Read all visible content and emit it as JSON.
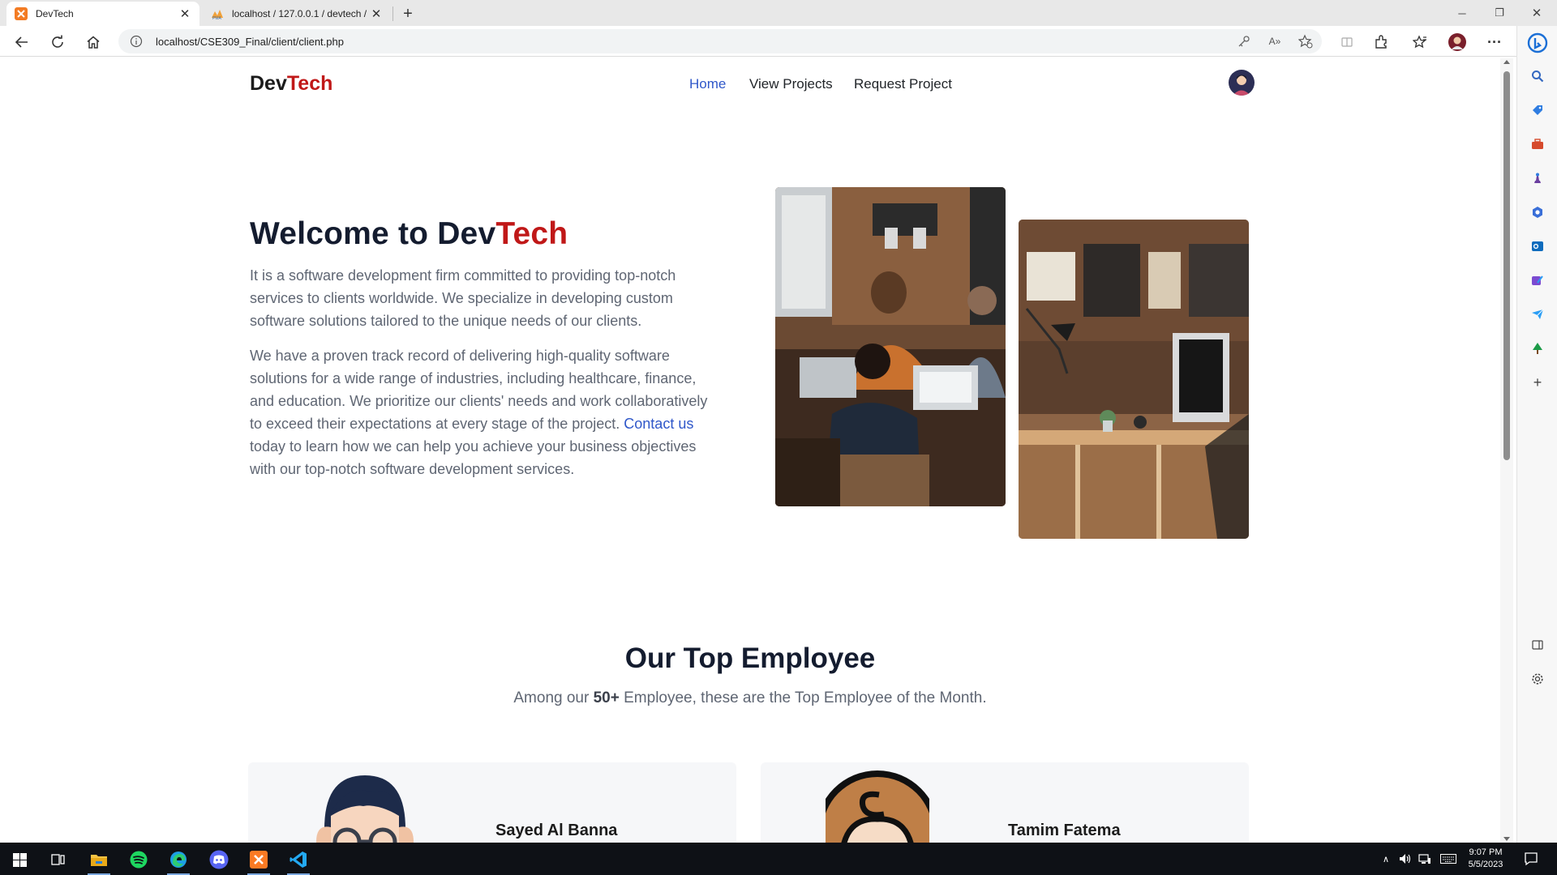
{
  "browser": {
    "tabs": [
      {
        "title": "DevTech",
        "active": true
      },
      {
        "title": "localhost / 127.0.0.1 / devtech / …",
        "active": false
      }
    ],
    "url": "localhost/CSE309_Final/client/client.php"
  },
  "site": {
    "brand_main": "Dev",
    "brand_accent": "Tech",
    "nav": [
      "Home",
      "View Projects",
      "Request Project"
    ],
    "active_nav": "Home"
  },
  "hero": {
    "title_prefix": "Welcome to Dev",
    "title_accent": "Tech",
    "paragraph1": "It is a software development firm committed to providing top-notch services to clients worldwide. We specialize in developing custom software solutions tailored to the unique needs of our clients.",
    "paragraph2_before": "We have a proven track record of delivering high-quality software solutions for a wide range of industries, including healthcare, finance, and education. We prioritize our clients' needs and work collaboratively to exceed their expectations at every stage of the project. ",
    "contact_link": "Contact us",
    "paragraph2_after": " today to learn how we can help you achieve your business objectives with our top-notch software development services."
  },
  "team": {
    "title": "Our Top Employee",
    "subtitle_before": "Among our ",
    "subtitle_bold": "50+",
    "subtitle_after": " Employee, these are the Top Employee of the Month.",
    "employees": [
      {
        "name": "Sayed Al Banna",
        "avatar": "man-with-glasses-avatar"
      },
      {
        "name": "Tamim Fatema",
        "avatar": "woman-avatar"
      }
    ]
  },
  "taskbar": {
    "apps": [
      "file-explorer",
      "spotify",
      "edge",
      "discord",
      "xampp",
      "vscode"
    ],
    "time": "9:07 PM",
    "date": "5/5/2023"
  },
  "colors": {
    "brand_accent": "#c01818",
    "link": "#2f57c9",
    "heading": "#141c2f",
    "body_text": "#5f6673"
  }
}
